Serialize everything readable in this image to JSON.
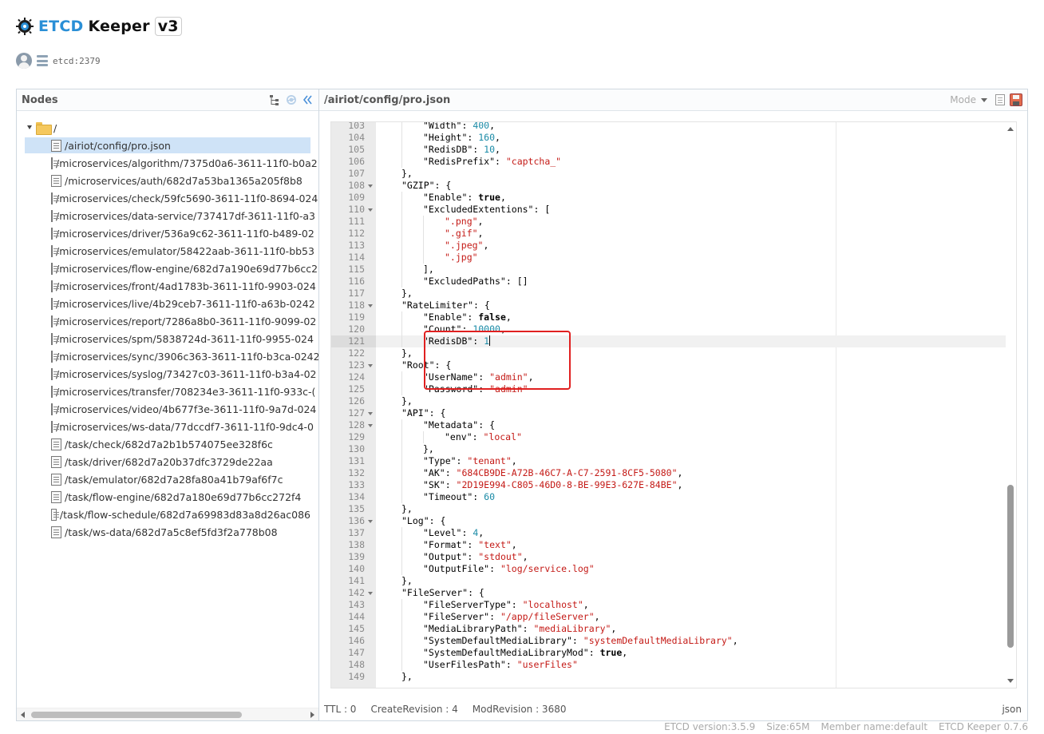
{
  "header": {
    "title_part1": "ETCD",
    "title_part2": "Keeper",
    "title_part3": "v3",
    "connection": "etcd:2379"
  },
  "nodes_panel": {
    "title": "Nodes",
    "items": [
      {
        "label": "/",
        "type": "folder"
      },
      {
        "label": "/airiot/config/pro.json",
        "type": "file",
        "selected": true
      },
      {
        "label": "/microservices/algorithm/7375d0a6-3611-11f0-b0a2",
        "type": "file"
      },
      {
        "label": "/microservices/auth/682d7a53ba1365a205f8b8",
        "type": "file"
      },
      {
        "label": "/microservices/check/59fc5690-3611-11f0-8694-024",
        "type": "file"
      },
      {
        "label": "/microservices/data-service/737417df-3611-11f0-a3",
        "type": "file"
      },
      {
        "label": "/microservices/driver/536a9c62-3611-11f0-b489-02",
        "type": "file"
      },
      {
        "label": "/microservices/emulator/58422aab-3611-11f0-bb53",
        "type": "file"
      },
      {
        "label": "/microservices/flow-engine/682d7a190e69d77b6cc2",
        "type": "file"
      },
      {
        "label": "/microservices/front/4ad1783b-3611-11f0-9903-024",
        "type": "file"
      },
      {
        "label": "/microservices/live/4b29ceb7-3611-11f0-a63b-0242",
        "type": "file"
      },
      {
        "label": "/microservices/report/7286a8b0-3611-11f0-9099-02",
        "type": "file"
      },
      {
        "label": "/microservices/spm/5838724d-3611-11f0-9955-024",
        "type": "file"
      },
      {
        "label": "/microservices/sync/3906c363-3611-11f0-b3ca-0242",
        "type": "file"
      },
      {
        "label": "/microservices/syslog/73427c03-3611-11f0-b3a4-02",
        "type": "file"
      },
      {
        "label": "/microservices/transfer/708234e3-3611-11f0-933c-(",
        "type": "file"
      },
      {
        "label": "/microservices/video/4b677f3e-3611-11f0-9a7d-024",
        "type": "file"
      },
      {
        "label": "/microservices/ws-data/77dccdf7-3611-11f0-9dc4-0",
        "type": "file"
      },
      {
        "label": "/task/check/682d7a2b1b574075ee328f6c",
        "type": "file"
      },
      {
        "label": "/task/driver/682d7a20b37dfc3729de22aa",
        "type": "file"
      },
      {
        "label": "/task/emulator/682d7a28fa80a41b79af6f7c",
        "type": "file"
      },
      {
        "label": "/task/flow-engine/682d7a180e69d77b6cc272f4",
        "type": "file"
      },
      {
        "label": "/task/flow-schedule/682d7a69983d83a8d26ac086",
        "type": "file"
      },
      {
        "label": "/task/ws-data/682d7a5c8ef5fd3f2a778b08",
        "type": "file"
      }
    ]
  },
  "editor_panel": {
    "path": "/airiot/config/pro.json",
    "mode_label": "Mode",
    "format": "json",
    "lines": [
      {
        "num": 103,
        "indent": 2,
        "tokens": [
          [
            "k",
            "\"Width\": "
          ],
          [
            "n",
            "400"
          ],
          [
            "k",
            ","
          ]
        ]
      },
      {
        "num": 104,
        "indent": 2,
        "tokens": [
          [
            "k",
            "\"Height\": "
          ],
          [
            "n",
            "160"
          ],
          [
            "k",
            ","
          ]
        ]
      },
      {
        "num": 105,
        "indent": 2,
        "tokens": [
          [
            "k",
            "\"RedisDB\": "
          ],
          [
            "n",
            "10"
          ],
          [
            "k",
            ","
          ]
        ]
      },
      {
        "num": 106,
        "indent": 2,
        "tokens": [
          [
            "k",
            "\"RedisPrefix\": "
          ],
          [
            "s",
            "\"captcha_\""
          ]
        ]
      },
      {
        "num": 107,
        "indent": 1,
        "tokens": [
          [
            "k",
            "},"
          ]
        ]
      },
      {
        "num": 108,
        "indent": 1,
        "fold": true,
        "tokens": [
          [
            "k",
            "\"GZIP\": {"
          ]
        ]
      },
      {
        "num": 109,
        "indent": 2,
        "tokens": [
          [
            "k",
            "\"Enable\": "
          ],
          [
            "b",
            "true"
          ],
          [
            "k",
            ","
          ]
        ]
      },
      {
        "num": 110,
        "indent": 2,
        "fold": true,
        "tokens": [
          [
            "k",
            "\"ExcludedExtentions\": ["
          ]
        ]
      },
      {
        "num": 111,
        "indent": 3,
        "tokens": [
          [
            "s",
            "\".png\""
          ],
          [
            "k",
            ","
          ]
        ]
      },
      {
        "num": 112,
        "indent": 3,
        "tokens": [
          [
            "s",
            "\".gif\""
          ],
          [
            "k",
            ","
          ]
        ]
      },
      {
        "num": 113,
        "indent": 3,
        "tokens": [
          [
            "s",
            "\".jpeg\""
          ],
          [
            "k",
            ","
          ]
        ]
      },
      {
        "num": 114,
        "indent": 3,
        "tokens": [
          [
            "s",
            "\".jpg\""
          ]
        ]
      },
      {
        "num": 115,
        "indent": 2,
        "tokens": [
          [
            "k",
            "],"
          ]
        ]
      },
      {
        "num": 116,
        "indent": 2,
        "tokens": [
          [
            "k",
            "\"ExcludedPaths\": []"
          ]
        ]
      },
      {
        "num": 117,
        "indent": 1,
        "tokens": [
          [
            "k",
            "},"
          ]
        ]
      },
      {
        "num": 118,
        "indent": 1,
        "fold": true,
        "tokens": [
          [
            "k",
            "\"RateLimiter\": {"
          ]
        ]
      },
      {
        "num": 119,
        "indent": 2,
        "tokens": [
          [
            "k",
            "\"Enable\": "
          ],
          [
            "b",
            "false"
          ],
          [
            "k",
            ","
          ]
        ]
      },
      {
        "num": 120,
        "indent": 2,
        "tokens": [
          [
            "k",
            "\"Count\": "
          ],
          [
            "n",
            "10000"
          ],
          [
            "k",
            ","
          ]
        ]
      },
      {
        "num": 121,
        "indent": 2,
        "current": true,
        "tokens": [
          [
            "k",
            "\"RedisDB\": "
          ],
          [
            "n",
            "1"
          ]
        ]
      },
      {
        "num": 122,
        "indent": 1,
        "tokens": [
          [
            "k",
            "},"
          ]
        ]
      },
      {
        "num": 123,
        "indent": 1,
        "fold": true,
        "tokens": [
          [
            "k",
            "\"Root\": {"
          ]
        ]
      },
      {
        "num": 124,
        "indent": 2,
        "tokens": [
          [
            "k",
            "\"UserName\": "
          ],
          [
            "s",
            "\"admin\""
          ],
          [
            "k",
            ","
          ]
        ]
      },
      {
        "num": 125,
        "indent": 2,
        "tokens": [
          [
            "k",
            "\"Password\": "
          ],
          [
            "s",
            "\"admin\""
          ]
        ]
      },
      {
        "num": 126,
        "indent": 1,
        "tokens": [
          [
            "k",
            "},"
          ]
        ]
      },
      {
        "num": 127,
        "indent": 1,
        "fold": true,
        "tokens": [
          [
            "k",
            "\"API\": {"
          ]
        ]
      },
      {
        "num": 128,
        "indent": 2,
        "fold": true,
        "tokens": [
          [
            "k",
            "\"Metadata\": {"
          ]
        ]
      },
      {
        "num": 129,
        "indent": 3,
        "tokens": [
          [
            "k",
            "\"env\": "
          ],
          [
            "s",
            "\"local\""
          ]
        ]
      },
      {
        "num": 130,
        "indent": 2,
        "tokens": [
          [
            "k",
            "},"
          ]
        ]
      },
      {
        "num": 131,
        "indent": 2,
        "tokens": [
          [
            "k",
            "\"Type\": "
          ],
          [
            "s",
            "\"tenant\""
          ],
          [
            "k",
            ","
          ]
        ]
      },
      {
        "num": 132,
        "indent": 2,
        "tokens": [
          [
            "k",
            "\"AK\": "
          ],
          [
            "s",
            "\"684CB9DE-A72B-46C7-A-C7-2591-8CF5-5080\""
          ],
          [
            "k",
            ","
          ]
        ]
      },
      {
        "num": 133,
        "indent": 2,
        "tokens": [
          [
            "k",
            "\"SK\": "
          ],
          [
            "s",
            "\"2D19E994-C805-46D0-8-BE-99E3-627E-84BE\""
          ],
          [
            "k",
            ","
          ]
        ]
      },
      {
        "num": 134,
        "indent": 2,
        "tokens": [
          [
            "k",
            "\"Timeout\": "
          ],
          [
            "n",
            "60"
          ]
        ]
      },
      {
        "num": 135,
        "indent": 1,
        "tokens": [
          [
            "k",
            "},"
          ]
        ]
      },
      {
        "num": 136,
        "indent": 1,
        "fold": true,
        "tokens": [
          [
            "k",
            "\"Log\": {"
          ]
        ]
      },
      {
        "num": 137,
        "indent": 2,
        "tokens": [
          [
            "k",
            "\"Level\": "
          ],
          [
            "n",
            "4"
          ],
          [
            "k",
            ","
          ]
        ]
      },
      {
        "num": 138,
        "indent": 2,
        "tokens": [
          [
            "k",
            "\"Format\": "
          ],
          [
            "s",
            "\"text\""
          ],
          [
            "k",
            ","
          ]
        ]
      },
      {
        "num": 139,
        "indent": 2,
        "tokens": [
          [
            "k",
            "\"Output\": "
          ],
          [
            "s",
            "\"stdout\""
          ],
          [
            "k",
            ","
          ]
        ]
      },
      {
        "num": 140,
        "indent": 2,
        "tokens": [
          [
            "k",
            "\"OutputFile\": "
          ],
          [
            "s",
            "\"log/service.log\""
          ]
        ]
      },
      {
        "num": 141,
        "indent": 1,
        "tokens": [
          [
            "k",
            "},"
          ]
        ]
      },
      {
        "num": 142,
        "indent": 1,
        "fold": true,
        "tokens": [
          [
            "k",
            "\"FileServer\": {"
          ]
        ]
      },
      {
        "num": 143,
        "indent": 2,
        "tokens": [
          [
            "k",
            "\"FileServerType\": "
          ],
          [
            "s",
            "\"localhost\""
          ],
          [
            "k",
            ","
          ]
        ]
      },
      {
        "num": 144,
        "indent": 2,
        "tokens": [
          [
            "k",
            "\"FileServer\": "
          ],
          [
            "s",
            "\"/app/fileServer\""
          ],
          [
            "k",
            ","
          ]
        ]
      },
      {
        "num": 145,
        "indent": 2,
        "tokens": [
          [
            "k",
            "\"MediaLibraryPath\": "
          ],
          [
            "s",
            "\"mediaLibrary\""
          ],
          [
            "k",
            ","
          ]
        ]
      },
      {
        "num": 146,
        "indent": 2,
        "tokens": [
          [
            "k",
            "\"SystemDefaultMediaLibrary\": "
          ],
          [
            "s",
            "\"systemDefaultMediaLibrary\""
          ],
          [
            "k",
            ","
          ]
        ]
      },
      {
        "num": 147,
        "indent": 2,
        "tokens": [
          [
            "k",
            "\"SystemDefaultMediaLibraryMod\": "
          ],
          [
            "b",
            "true"
          ],
          [
            "k",
            ","
          ]
        ]
      },
      {
        "num": 148,
        "indent": 2,
        "tokens": [
          [
            "k",
            "\"UserFilesPath\": "
          ],
          [
            "s",
            "\"userFiles\""
          ]
        ]
      },
      {
        "num": 149,
        "indent": 1,
        "tokens": [
          [
            "k",
            "},"
          ]
        ]
      }
    ],
    "meta": {
      "ttl": "TTL : 0",
      "create_revision": "CreateRevision : 4",
      "mod_revision": "ModRevision : 3680"
    }
  },
  "footer": {
    "etcd_version": "ETCD version:3.5.9",
    "size": "Size:65M",
    "member_name": "Member name:default",
    "keeper_version": "ETCD Keeper 0.7.6"
  },
  "colors": {
    "brand": "#2a8fd6",
    "highlight_box": "#e02020",
    "selection": "#cfe3f7"
  }
}
